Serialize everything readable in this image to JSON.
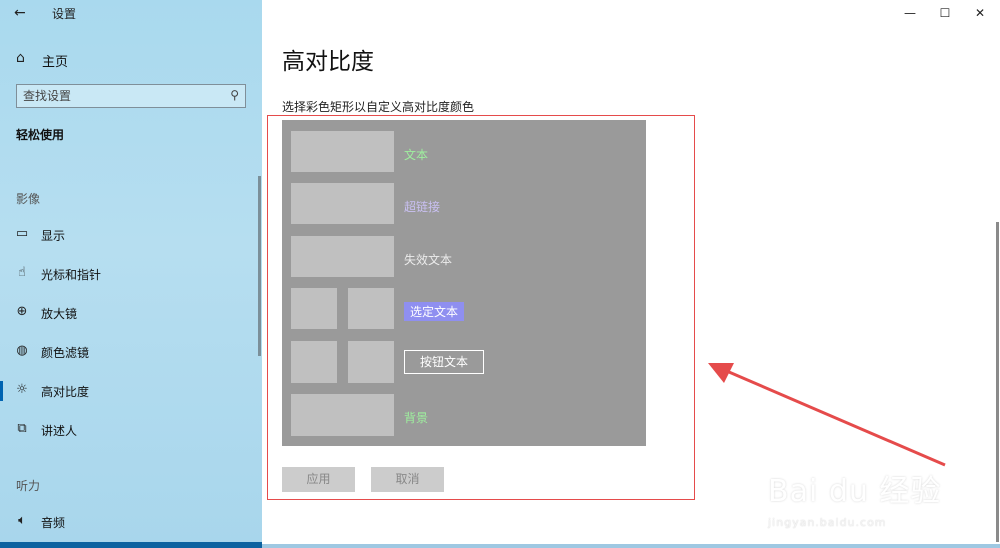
{
  "app": {
    "title": "设置",
    "back_icon": "arrow-left-icon"
  },
  "window": {
    "minimize": "—",
    "maximize": "☐",
    "close": "✕"
  },
  "sidebar": {
    "home_label": "主页",
    "search_placeholder": "查找设置",
    "current_section": "轻松使用",
    "groups": [
      {
        "label": "影像"
      },
      {
        "label": "听力"
      }
    ],
    "items": [
      {
        "label": "显示",
        "icon": "monitor-icon"
      },
      {
        "label": "光标和指针",
        "icon": "pointer-icon"
      },
      {
        "label": "放大镜",
        "icon": "magnifier-icon"
      },
      {
        "label": "颜色滤镜",
        "icon": "palette-icon"
      },
      {
        "label": "高对比度",
        "icon": "sun-icon",
        "active": true
      },
      {
        "label": "讲述人",
        "icon": "narrator-icon"
      },
      {
        "label": "音频",
        "icon": "speaker-icon"
      }
    ]
  },
  "main": {
    "title": "高对比度",
    "instruction": "选择彩色矩形以自定义高对比度颜色",
    "preview": {
      "text_label": "文本",
      "hyperlink_label": "超链接",
      "disabled_label": "失效文本",
      "selected_label": "选定文本",
      "button_label": "按钮文本",
      "background_label": "背景"
    },
    "apply_label": "应用",
    "cancel_label": "取消"
  },
  "watermark": {
    "main": "Bai du 经验",
    "sub": "jingyan.baidu.com"
  },
  "colors": {
    "sidebar_bg": "#b0dcef",
    "preview_bg": "#9a9a9a",
    "swatch": "#c0c0c0",
    "text_color": "#9ef09e",
    "link_color": "#c9c0f2",
    "selected_bg": "#8f8ff0",
    "annotation": "#e54b4b"
  }
}
